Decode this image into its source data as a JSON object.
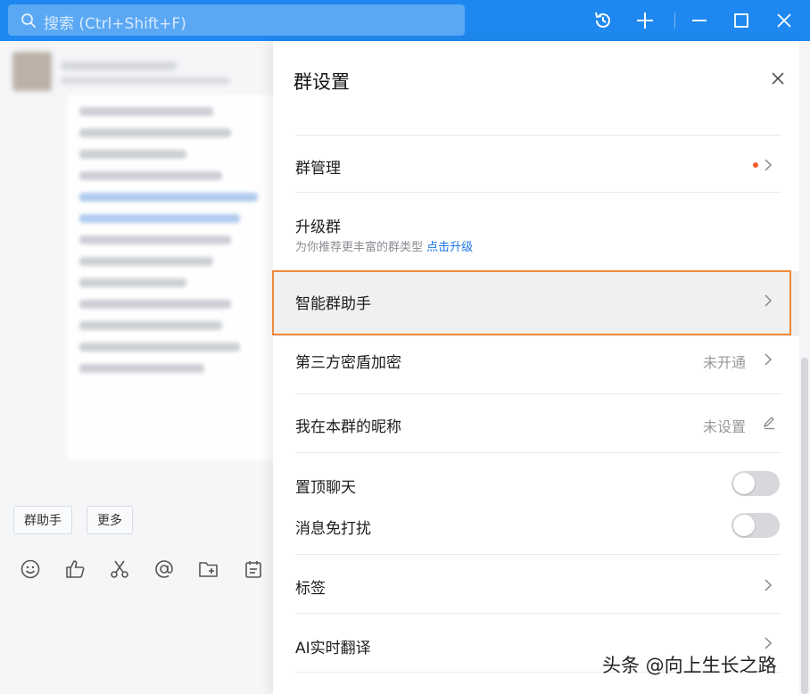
{
  "search": {
    "placeholder": "搜索 (Ctrl+Shift+F)"
  },
  "chat": {
    "quick_actions": [
      "群助手",
      "更多"
    ]
  },
  "panel": {
    "title": "群设置",
    "rows": {
      "group_manage": {
        "label": "群管理"
      },
      "upgrade": {
        "label": "升级群",
        "sub": "为你推荐更丰富的群类型",
        "link": "点击升级"
      },
      "assistant": {
        "label": "智能群助手"
      },
      "third_party": {
        "label": "第三方密盾加密",
        "value": "未开通"
      },
      "nickname": {
        "label": "我在本群的昵称",
        "value": "未设置"
      },
      "pin": {
        "label": "置顶聊天",
        "on": false
      },
      "mute": {
        "label": "消息免打扰",
        "on": false
      },
      "tags": {
        "label": "标签"
      },
      "ai_translate": {
        "label": "AI实时翻译"
      }
    }
  },
  "watermark": "头条 @向上生长之路",
  "colors": {
    "brand": "#1e88f0",
    "notice_dot": "#f25a2a",
    "link": "#1e78e6",
    "highlight_border": "#f0893b"
  }
}
